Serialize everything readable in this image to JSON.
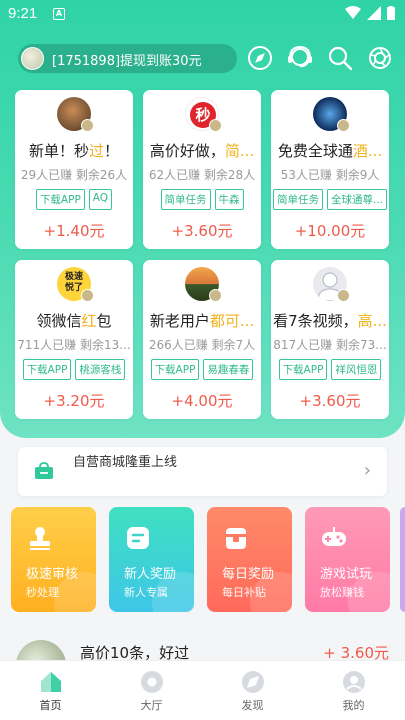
{
  "status_bar": {
    "time": "9:21",
    "notification_icon": "A"
  },
  "header": {
    "notice": "[1751898]提现到账30元",
    "icons": [
      "compass-icon",
      "support-agent-icon",
      "search-icon",
      "aperture-icon"
    ]
  },
  "cards": [
    {
      "title_pre": "新单！秒",
      "title_hl": "过",
      "title_post": "！",
      "stats": "29人已赚  剩余26人",
      "tags": [
        "下载APP",
        "AQ"
      ],
      "reward": "+1.40元"
    },
    {
      "title_pre": "高价好做，",
      "title_hl": "简...",
      "title_post": "",
      "stats": "62人已赚  剩余28人",
      "tags": [
        "简单任务",
        "牛森"
      ],
      "reward": "+3.60元"
    },
    {
      "title_pre": "免费全球通",
      "title_hl": "酒...",
      "title_post": "",
      "stats": "53人已赚  剩余9人",
      "tags": [
        "简单任务",
        "全球通尊..."
      ],
      "reward": "+10.00元"
    },
    {
      "title_pre": "领微信",
      "title_hl": "红",
      "title_post": "包",
      "stats": "711人已赚  剩余13...",
      "tags": [
        "下载APP",
        "桃源客栈"
      ],
      "reward": "+3.20元"
    },
    {
      "title_pre": "新老用户",
      "title_hl": "都可...",
      "title_post": "",
      "stats": "266人已赚  剩余7人",
      "tags": [
        "下载APP",
        "易趣春春"
      ],
      "reward": "+4.00元"
    },
    {
      "title_pre": "看7条视频，",
      "title_hl": "高...",
      "title_post": "",
      "stats": "817人已赚  剩余73...",
      "tags": [
        "下载APP",
        "祥风恒恩"
      ],
      "reward": "+3.60元"
    }
  ],
  "card_avatar_texts": {
    "flash": "秒",
    "speed": "极速\n悦了"
  },
  "banner": {
    "text": "自营商城隆重上线",
    "arrow": "›"
  },
  "tiles": [
    {
      "title": "极速审核",
      "subtitle": "秒处理",
      "color_top": "#ffcf4a",
      "color_bottom": "#ffb020",
      "icon": "stamp-icon"
    },
    {
      "title": "新人奖励",
      "subtitle": "新人专属",
      "color_top": "#3fe0c0",
      "color_bottom": "#3ec6e8",
      "icon": "message-icon"
    },
    {
      "title": "每日奖励",
      "subtitle": "每日补贴",
      "color_top": "#ff8a6a",
      "color_bottom": "#ff6a5a",
      "icon": "gift-icon"
    },
    {
      "title": "游戏试玩",
      "subtitle": "放松赚钱",
      "color_top": "#ff9ab8",
      "color_bottom": "#ff7aa6",
      "icon": "gamepad-icon"
    }
  ],
  "list_item": {
    "title": "高价10条，好过",
    "reward": "+ 3.60元"
  },
  "bottom_nav": [
    {
      "label": "首页",
      "icon": "home-icon",
      "active": true
    },
    {
      "label": "大厅",
      "icon": "hall-icon",
      "active": false
    },
    {
      "label": "发现",
      "icon": "discover-icon",
      "active": false
    },
    {
      "label": "我的",
      "icon": "profile-icon",
      "active": false
    }
  ],
  "colors": {
    "primary": "#2fd3a6",
    "reward": "#f05a4a",
    "highlight": "#f2b21a",
    "tag": "#36c79b"
  }
}
